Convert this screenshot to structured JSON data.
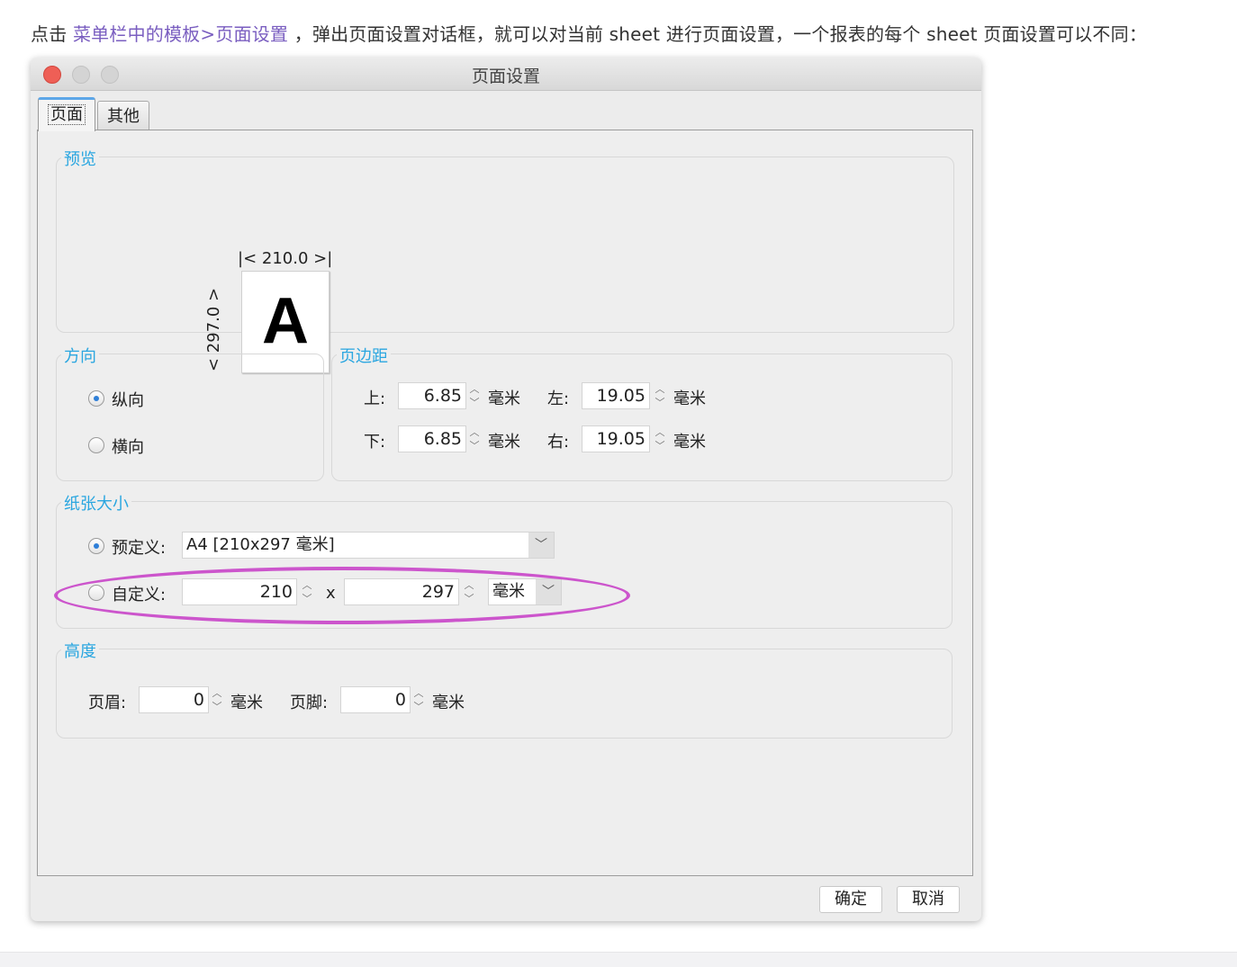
{
  "intro": {
    "prefix": "点击",
    "link": "菜单栏中的模板>页面设置",
    "suffix": "，弹出页面设置对话框，就可以对当前 sheet 进行页面设置，一个报表的每个 sheet 页面设置可以不同："
  },
  "dialog": {
    "title": "页面设置",
    "tabs": [
      "页面",
      "其他"
    ],
    "preview": {
      "legend": "预览",
      "width_label": "210.0",
      "height_label": "297.0",
      "letter": "A"
    },
    "orientation": {
      "legend": "方向",
      "portrait": "纵向",
      "landscape": "横向",
      "selected": "portrait"
    },
    "margins": {
      "legend": "页边距",
      "top_label": "上:",
      "top_value": "6.85",
      "bottom_label": "下:",
      "bottom_value": "6.85",
      "left_label": "左:",
      "left_value": "19.05",
      "right_label": "右:",
      "right_value": "19.05",
      "unit": "毫米"
    },
    "paper": {
      "legend": "纸张大小",
      "predefined_label": "预定义:",
      "predefined_value": "A4 [210x297 毫米]",
      "custom_label": "自定义:",
      "custom_width": "210",
      "times": "x",
      "custom_height": "297",
      "unit": "毫米",
      "selected": "predefined"
    },
    "height": {
      "legend": "高度",
      "header_label": "页眉:",
      "header_value": "0",
      "footer_label": "页脚:",
      "footer_value": "0",
      "unit": "毫米"
    },
    "buttons": {
      "ok": "确定",
      "cancel": "取消"
    }
  },
  "colors": {
    "accent": "#2aa6e0",
    "highlight": "#cc55cc",
    "link": "#7a5ec0"
  }
}
